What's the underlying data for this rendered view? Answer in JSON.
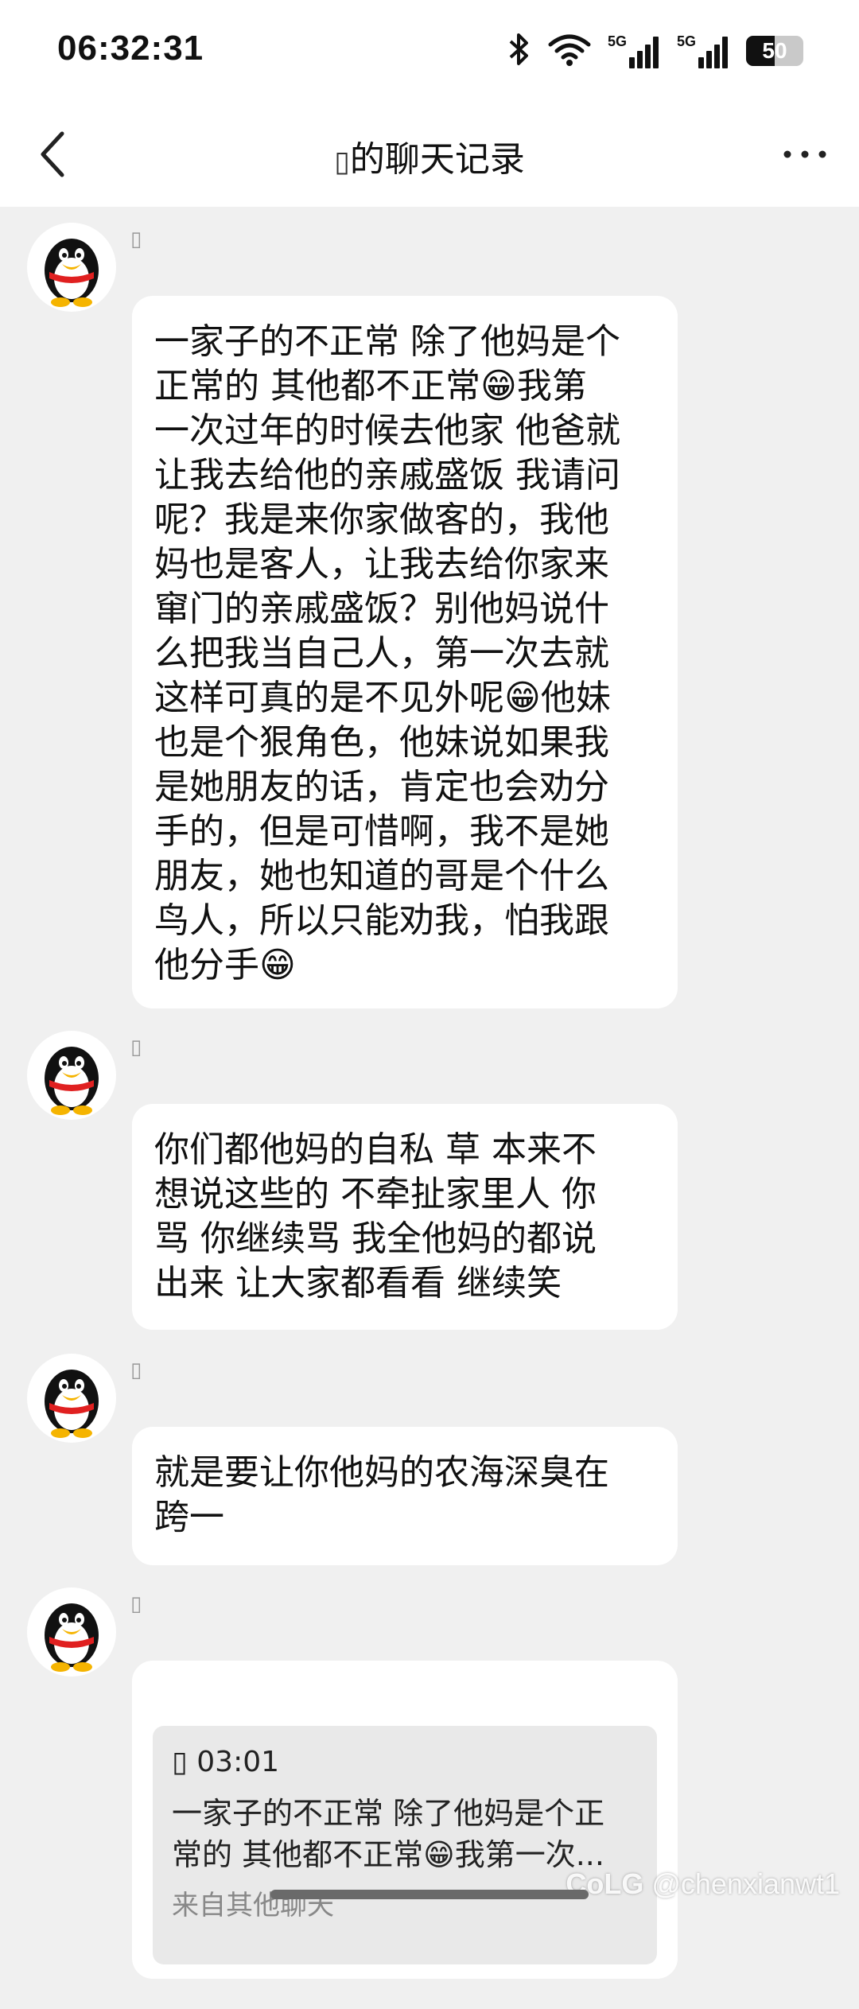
{
  "status_bar": {
    "time": "06:32:31",
    "signal1_label": "5G",
    "signal2_label": "5G",
    "battery": "50",
    "battery_level": 0.5
  },
  "nav": {
    "title": "的聊天记录"
  },
  "messages": [
    {
      "sender": "",
      "text": "一家子的不正常 除了他妈是个\n正常的 其他都不正常😁我第\n一次过年的时候去他家 他爸就\n让我去给他的亲戚盛饭 我请问\n呢？我是来你家做客的，我他\n妈也是客人，让我去给你家来\n窜门的亲戚盛饭？别他妈说什\n么把我当自己人，第一次去就\n这样可真的是不见外呢😁他妹\n也是个狠角色，他妹说如果我\n是她朋友的话，肯定也会劝分\n手的，但是可惜啊，我不是她\n朋友，她也知道的哥是个什么\n鸟人，所以只能劝我，怕我跟\n他分手😁"
    },
    {
      "sender": "",
      "text": "你们都他妈的自私 草 本来不\n想说这些的 不牵扯家里人 你\n骂 你继续骂 我全他妈的都说\n出来 让大家都看看 继续笑"
    },
    {
      "sender": "",
      "text": "就是要让你他妈的农海深臭在\n跨一"
    },
    {
      "sender": "",
      "quote": {
        "time": "03:01",
        "text": "一家子的不正常 除了他妈是个正\n常的 其他都不正常😁我第一次...",
        "source": "来自其他聊天"
      }
    }
  ],
  "watermark": "@chenxianwt1"
}
